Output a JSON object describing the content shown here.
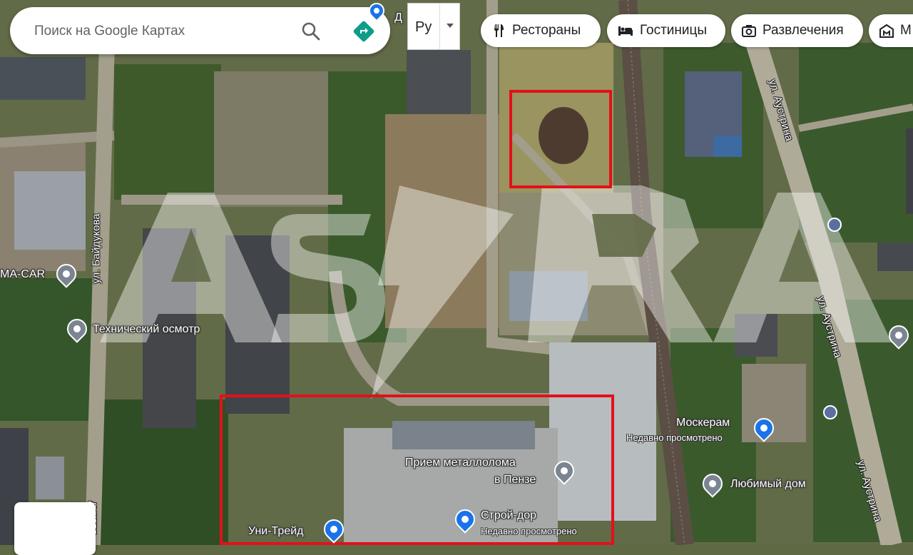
{
  "search": {
    "placeholder": "Поиск на Google Картах"
  },
  "language": {
    "label": "Ру"
  },
  "chips": [
    {
      "label": "Рестораны",
      "icon": "fork-knife-icon"
    },
    {
      "label": "Гостиницы",
      "icon": "bed-icon"
    },
    {
      "label": "Развлечения",
      "icon": "camera-icon"
    },
    {
      "label": "М",
      "icon": "museum-icon"
    }
  ],
  "places": {
    "tech_inspection": "Технический осмотр",
    "ma_car": "MA-CAR",
    "metal_scrap_line1": "Прием металлолома",
    "metal_scrap_line2": "в Пензе",
    "stroy_dor": "Строй-дор",
    "stroy_dor_sub": "Недавно просмотрено",
    "uni_treid": "Уни-Трейд",
    "moskeram": "Москерам",
    "moskeram_sub": "Недавно просмотрено",
    "lyubimy_dom": "Любимый дом",
    "top_partial": "Д"
  },
  "streets": {
    "baidukova": "ул. Байдукова",
    "baidukova_bottom": "дукова",
    "austrina_top": "ул. Аустрина",
    "austrina_mid": "ул. Аустрина",
    "austrina_bottom": "ул. Аустрина"
  },
  "watermark": "ASTRA",
  "colors": {
    "highlight": "#e3101a",
    "pin_blue": "#1a73e8",
    "pin_gray": "#7b8591",
    "directions": "#0f9d8a"
  }
}
